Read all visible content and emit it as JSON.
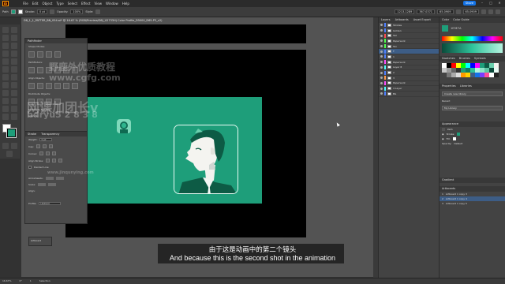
{
  "menubar": {
    "logo": "Ai",
    "items": [
      "File",
      "Edit",
      "Object",
      "Type",
      "Select",
      "Effect",
      "View",
      "Window",
      "Help"
    ],
    "share_label": "Share"
  },
  "controlbar": {
    "selection_label": "Path",
    "stroke_label": "Stroke:",
    "stroke_value": "0 pt",
    "opacity_label": "Opacity:",
    "opacity_value": "100%",
    "style_label": "Style:",
    "x_value": "1213.1289",
    "y_value": "367.0371",
    "w_value": "65.0909",
    "h_value": "65.0909"
  },
  "document_tab": "D8_1_1_PATTER_BN_054.ai* @ 16.67 % (RGB/Preview/D8J_U2733H) Color Profile_D5000_D65-P3_v2)",
  "pathfinder": {
    "title": "Pathfinder",
    "shape_modes_label": "Shape Modes:",
    "pathfinders_label": "Pathfinders:",
    "align_label": "Align Objects:",
    "distribute_label": "Distribute Objects:",
    "distribute_spacing_label": "Distribute Spacing:",
    "align_to_label": "Align To:"
  },
  "stroke_panel": {
    "tab_stroke": "Stroke",
    "tab_transparency": "Transparency",
    "weight_label": "Weight:",
    "weight_value": "0 pt",
    "cap_label": "Cap:",
    "corner_label": "Corner:",
    "align_stroke_label": "Align Stroke:",
    "dashed_line_label": "Dashed Line",
    "arrowheads_label": "Arrowheads:",
    "scale_label": "Scale:",
    "align_label": "Align:",
    "profile_label": "Profile:",
    "profile_value": "Uniform"
  },
  "small_panel_label": "Artboard",
  "watermark": {
    "site_cn": "野鹿外优质教程",
    "site_url": "www.cgfg.com",
    "cn_line2": "网课加团长v",
    "id_line": "bdryu5 2 8 3 8",
    "small": "www.jinqunying.com"
  },
  "subtitles": {
    "chinese": "由于这是动画中的第二个镜头",
    "english": "And because this is the second shot in the animation"
  },
  "statusbar": {
    "zoom": "16.67%",
    "angle": "0°",
    "artboard_nav": "1",
    "tool": "Selection"
  },
  "layers_panel": {
    "tabs": [
      "Layers",
      "Artboards",
      "Asset Export"
    ],
    "rows": [
      {
        "name": "Strokes",
        "color": "#4f7fff",
        "selected": false
      },
      {
        "name": "Golden",
        "color": "#4f7fff",
        "selected": false
      },
      {
        "name": "Tail",
        "color": "#ff4f4f",
        "selected": false
      },
      {
        "name": "Paperwork",
        "color": "#4fff4f",
        "selected": false
      },
      {
        "name": "Tex",
        "color": "#4fff4f",
        "selected": false
      },
      {
        "name": "T",
        "color": "#4f7fff",
        "selected": true
      },
      {
        "name": "1",
        "color": "#4f7fff",
        "selected": false
      },
      {
        "name": "Paperwork",
        "color": "#ff4fff",
        "selected": false
      },
      {
        "name": "Layer 8",
        "color": "#4fffff",
        "selected": false
      },
      {
        "name": "2",
        "color": "#4f7fff",
        "selected": false
      },
      {
        "name": "3",
        "color": "#ff9a4f",
        "selected": false
      },
      {
        "name": "Paperwork",
        "color": "#ff4fff",
        "selected": false
      },
      {
        "name": "4 Layer",
        "color": "#4fffff",
        "selected": false
      },
      {
        "name": "BG",
        "color": "#4f7fff",
        "selected": false
      }
    ]
  },
  "right_panel": {
    "color_tabs": [
      "Color",
      "Color Guide"
    ],
    "hex_value": "1E9E7A",
    "swatch_tabs": [
      "Swatches",
      "Brushes",
      "Symbols"
    ],
    "properties_tabs": [
      "Properties",
      "Libraries"
    ],
    "create_library_label": "Create new library",
    "recent_label": "Recent",
    "my_library_label": "My Library",
    "appearance_title": "Appearance",
    "appearance_target": "Path",
    "stroke_label": "Stroke:",
    "fill_label": "Fill:",
    "opacity_label": "Opacity:",
    "opacity_value": "Default",
    "artboards_title": "Artboards",
    "gradient_title": "Gradient",
    "artboards": [
      "Artboard 1 copy 3",
      "Artboard 1 copy 4",
      "Artboard 1 copy 5"
    ]
  },
  "colors": {
    "teal": "#1e9e7a",
    "teal_dark": "#0d5b45",
    "accent_blue": "#1473e6",
    "selection": "#3d5d86"
  }
}
